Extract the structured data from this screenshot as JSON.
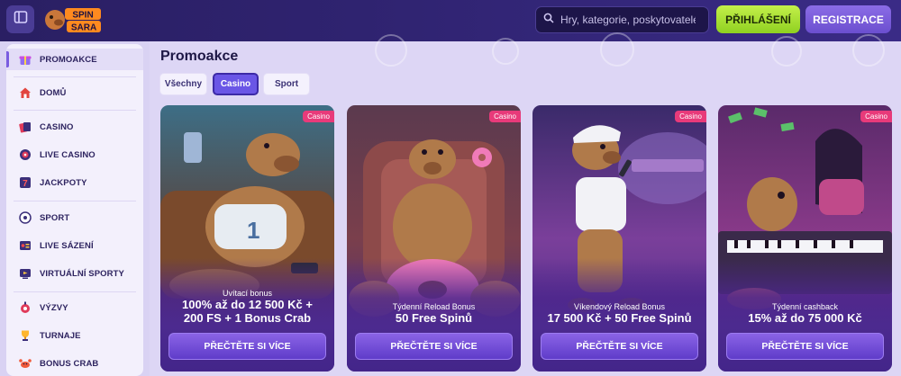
{
  "header": {
    "logo_text": "SPIN SARA",
    "search_placeholder": "Hry, kategorie, poskytovatelé",
    "login_label": "PŘIHLÁŠENÍ",
    "register_label": "REGISTRACE"
  },
  "sidebar": {
    "items": [
      {
        "label": "PROMOAKCE",
        "icon": "gift-icon",
        "active": true
      },
      {
        "label": "DOMŮ",
        "icon": "home-icon"
      },
      {
        "label": "CASINO",
        "icon": "cards-icon"
      },
      {
        "label": "LIVE CASINO",
        "icon": "roulette-icon"
      },
      {
        "label": "JACKPOTY",
        "icon": "slot-seven-icon"
      },
      {
        "label": "SPORT",
        "icon": "ball-icon"
      },
      {
        "label": "LIVE SÁZENÍ",
        "icon": "live-bet-icon"
      },
      {
        "label": "VIRTUÁLNÍ SPORTY",
        "icon": "virtual-sport-icon"
      },
      {
        "label": "VÝZVY",
        "icon": "challenge-icon"
      },
      {
        "label": "TURNAJE",
        "icon": "trophy-icon"
      },
      {
        "label": "BONUS CRAB",
        "icon": "crab-icon"
      }
    ]
  },
  "main": {
    "title": "Promoakce",
    "tabs": [
      {
        "label": "Všechny",
        "active": false
      },
      {
        "label": "Casino",
        "active": true
      },
      {
        "label": "Sport",
        "active": false
      }
    ],
    "cards": [
      {
        "badge": "Casino",
        "subtitle": "Uvítací bonus",
        "line1": "100% až do 12 500 Kč +",
        "line2": "200 FS + 1 Bonus Crab",
        "button": "PŘEČTĚTE SI VÍCE"
      },
      {
        "badge": "Casino",
        "subtitle": "Týdenní Reload Bonus",
        "line1": "50 Free Spinů",
        "line2": "",
        "button": "PŘEČTĚTE SI VÍCE"
      },
      {
        "badge": "Casino",
        "subtitle": "Víkendový Reload Bonus",
        "line1": "17 500 Kč + 50 Free Spinů",
        "line2": "",
        "button": "PŘEČTĚTE SI VÍCE"
      },
      {
        "badge": "Casino",
        "subtitle": "Týdenní cashback",
        "line1": "15% až do 75 000 Kč",
        "line2": "",
        "button": "PŘEČTĚTE SI VÍCE"
      }
    ]
  },
  "colors": {
    "header_bg": "#2f2370",
    "login_green": "#a8e036",
    "register_purple": "#7a5ce0",
    "accent": "#6a56e6",
    "badge_pink": "#e83a7a"
  }
}
